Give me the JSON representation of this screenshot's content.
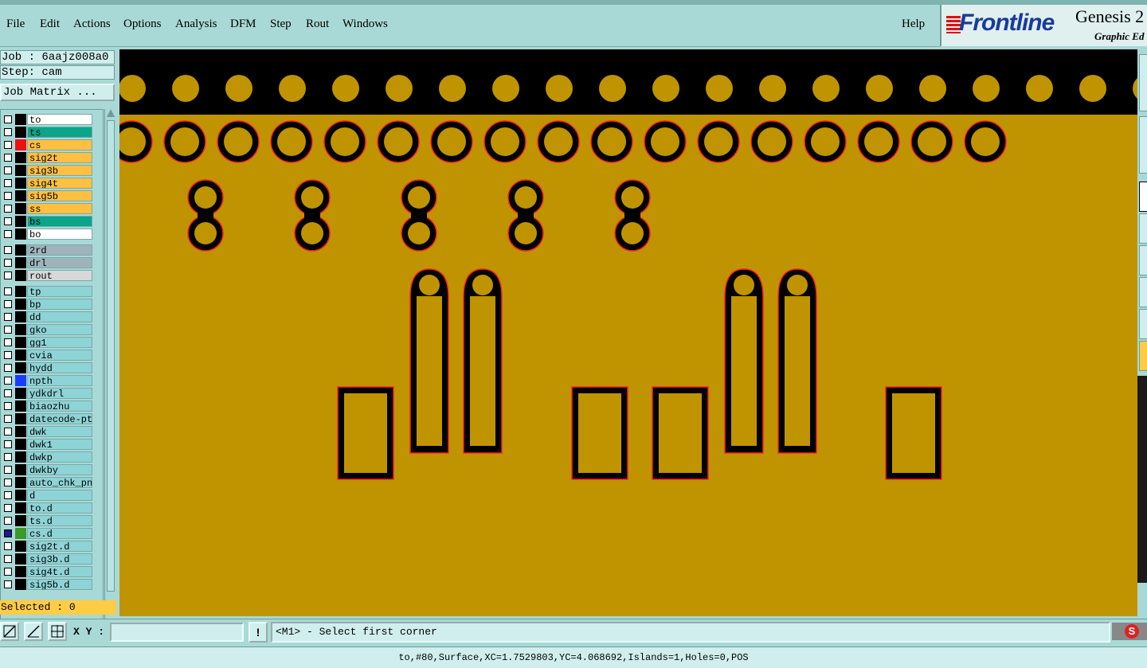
{
  "menubar": {
    "items": [
      "File",
      "Edit",
      "Actions",
      "Options",
      "Analysis",
      "DFM",
      "Step",
      "Rout",
      "Windows"
    ],
    "help": "Help"
  },
  "logo": {
    "brand": "Frontline",
    "product": "Genesis 2",
    "subtitle": "Graphic Ed"
  },
  "job": {
    "line": "Job : 6aajz008a0",
    "step": "Step: cam",
    "matrix_button": "Job Matrix ..."
  },
  "layers": [
    {
      "name": "to",
      "bg": "#ffffff",
      "swatch": "#000000",
      "mark": "✓"
    },
    {
      "name": "ts",
      "bg": "#0aa58a",
      "swatch": "#000000",
      "mark": ""
    },
    {
      "name": "cs",
      "bg": "#ffbf40",
      "swatch": "#ee1111",
      "mark": ""
    },
    {
      "name": "sig2t",
      "bg": "#ffbf40",
      "swatch": "#000000",
      "mark": ""
    },
    {
      "name": "sig3b",
      "bg": "#ffbf40",
      "swatch": "#000000",
      "mark": ""
    },
    {
      "name": "sig4t",
      "bg": "#ffbf40",
      "swatch": "#000000",
      "mark": ""
    },
    {
      "name": "sig5b",
      "bg": "#ffbf40",
      "swatch": "#000000",
      "mark": ""
    },
    {
      "name": "ss",
      "bg": "#ffbf40",
      "swatch": "#000000",
      "mark": "✓"
    },
    {
      "name": "bs",
      "bg": "#0aa58a",
      "swatch": "#000000",
      "mark": ""
    },
    {
      "name": "bo",
      "bg": "#ffffff",
      "swatch": "#000000",
      "mark": ""
    },
    {
      "name": "2rd",
      "bg": "#9fb3bb",
      "swatch": "#000000",
      "mark": ""
    },
    {
      "name": "drl",
      "bg": "#9fb3bb",
      "swatch": "#000000",
      "mark": ""
    },
    {
      "name": "rout",
      "bg": "#d8d8d8",
      "swatch": "#000000",
      "mark": ""
    },
    {
      "name": "tp",
      "bg": "#8ed3d6",
      "swatch": "#000000",
      "mark": ""
    },
    {
      "name": "bp",
      "bg": "#8ed3d6",
      "swatch": "#000000",
      "mark": ""
    },
    {
      "name": "dd",
      "bg": "#8ed3d6",
      "swatch": "#000000",
      "mark": "✓"
    },
    {
      "name": "gko",
      "bg": "#8ed3d6",
      "swatch": "#000000",
      "mark": "✓"
    },
    {
      "name": "gg1",
      "bg": "#8ed3d6",
      "swatch": "#000000",
      "mark": ""
    },
    {
      "name": "cvia",
      "bg": "#8ed3d6",
      "swatch": "#000000",
      "mark": ""
    },
    {
      "name": "hydd",
      "bg": "#8ed3d6",
      "swatch": "#000000",
      "mark": ""
    },
    {
      "name": "npth",
      "bg": "#8ed3d6",
      "swatch": "#1a3cff",
      "mark": ""
    },
    {
      "name": "ydkdrl",
      "bg": "#8ed3d6",
      "swatch": "#000000",
      "mark": ""
    },
    {
      "name": "biaozhu",
      "bg": "#8ed3d6",
      "swatch": "#000000",
      "mark": ""
    },
    {
      "name": "datecode-ptc",
      "bg": "#8ed3d6",
      "swatch": "#000000",
      "mark": ""
    },
    {
      "name": "dwk",
      "bg": "#8ed3d6",
      "swatch": "#000000",
      "mark": ""
    },
    {
      "name": "dwk1",
      "bg": "#8ed3d6",
      "swatch": "#000000",
      "mark": ""
    },
    {
      "name": "dwkp",
      "bg": "#8ed3d6",
      "swatch": "#000000",
      "mark": ""
    },
    {
      "name": "dwkby",
      "bg": "#8ed3d6",
      "swatch": "#000000",
      "mark": ""
    },
    {
      "name": "auto_chk_pnl",
      "bg": "#8ed3d6",
      "swatch": "#000000",
      "mark": ""
    },
    {
      "name": "d",
      "bg": "#8ed3d6",
      "swatch": "#000000",
      "mark": ""
    },
    {
      "name": "to.d",
      "bg": "#8ed3d6",
      "swatch": "#000000",
      "mark": "✓"
    },
    {
      "name": "ts.d",
      "bg": "#8ed3d6",
      "swatch": "#000000",
      "mark": ""
    },
    {
      "name": "cs.d",
      "bg": "#8ed3d6",
      "swatch": "#3a9a2a",
      "mark": "▫"
    },
    {
      "name": "sig2t.d",
      "bg": "#8ed3d6",
      "swatch": "#000000",
      "mark": ""
    },
    {
      "name": "sig3b.d",
      "bg": "#8ed3d6",
      "swatch": "#000000",
      "mark": ""
    },
    {
      "name": "sig4t.d",
      "bg": "#8ed3d6",
      "swatch": "#000000",
      "mark": ""
    },
    {
      "name": "sig5b.d",
      "bg": "#8ed3d6",
      "swatch": "#000000",
      "mark": ""
    }
  ],
  "selected": "Selected : 0",
  "toolbar": {
    "xy_label": "X Y :",
    "xy_value": "",
    "info_glyph": "!"
  },
  "prompt": "<M1> - Select first corner",
  "status": "to,#80,Surface,XC=1.7529803,YC=4.068692,Islands=1,Holes=0,POS",
  "tray": {
    "icon": "S"
  },
  "colors": {
    "board": "#bf9400",
    "outline": "#ff2020",
    "void": "#000000",
    "panel": "#a9d9d6"
  }
}
